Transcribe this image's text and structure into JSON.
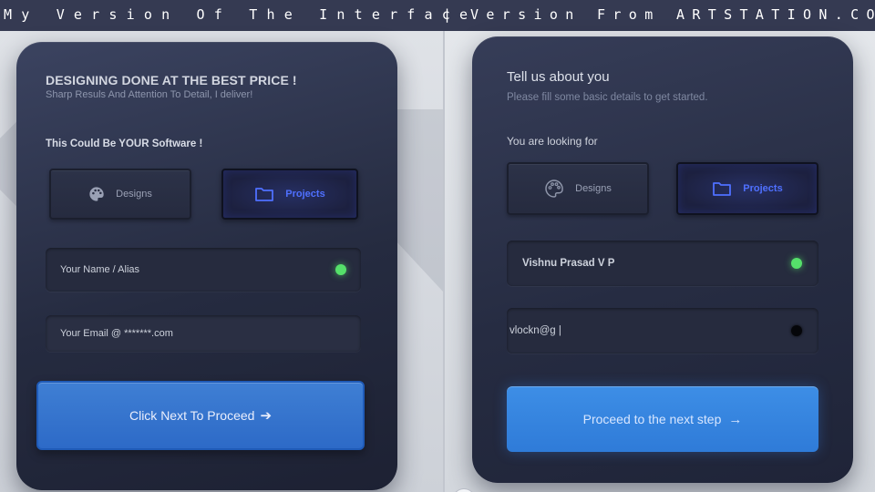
{
  "header": {
    "left_text": "My Version Of The Interface",
    "divider": "|",
    "right_text": "Version From ARTSTATION.COM"
  },
  "left_card": {
    "title": "DESIGNING DONE AT THE BEST PRICE !",
    "subtitle": "Sharp Resuls And Attention To Detail, I deliver!",
    "question": "This Could Be YOUR Software !",
    "options": [
      {
        "label": "Designs",
        "icon": "palette-icon",
        "selected": false
      },
      {
        "label": "Projects",
        "icon": "folder-icon",
        "selected": true
      }
    ],
    "name_field": {
      "placeholder": "Your Name / Alias",
      "status_color": "#55e06a"
    },
    "email_field": {
      "placeholder": "Your Email @ *******.com"
    },
    "cta_label": "Click Next To Proceed",
    "cta_arrow": "➔"
  },
  "right_card": {
    "title": "Tell us about you",
    "subtitle": "Please fill some basic details to get started.",
    "question": "You are looking for",
    "options": [
      {
        "label": "Designs",
        "icon": "palette-icon",
        "selected": false
      },
      {
        "label": "Projects",
        "icon": "folder-icon",
        "selected": true
      }
    ],
    "name_field": {
      "value": "Vishnu Prasad V P",
      "status_color": "#55e06a"
    },
    "email_field": {
      "value": "vlockn@g |",
      "status_color": "#05060a"
    },
    "cta_label": "Proceed to the next step",
    "cta_arrow": "→"
  },
  "colors": {
    "accent_blue": "#4f70ff",
    "cta_blue": "#3d8ee6",
    "card_dark": "#252b40"
  }
}
